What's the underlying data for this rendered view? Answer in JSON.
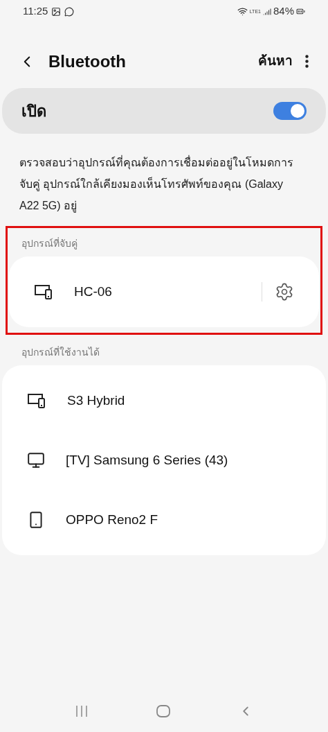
{
  "status_bar": {
    "time": "11:25",
    "network": "LTE1",
    "battery": "84%"
  },
  "header": {
    "title": "Bluetooth",
    "action": "ค้นหา"
  },
  "master_switch": {
    "label": "เปิด",
    "on": true
  },
  "description": "ตรวจสอบว่าอุปกรณ์ที่คุณต้องการเชื่อมต่ออยู่ในโหมดการจับคู่ อุปกรณ์ใกล้เคียงมองเห็นโทรศัพท์ของคุณ (Galaxy A22 5G) อยู่",
  "sections": [
    {
      "title": "อุปกรณ์ที่จับคู่",
      "highlighted": true,
      "devices": [
        {
          "kind": "multi",
          "name": "HC-06",
          "settings": true
        }
      ]
    },
    {
      "title": "อุปกรณ์ที่ใช้งานได้",
      "highlighted": false,
      "devices": [
        {
          "kind": "multi",
          "name": "S3 Hybrid",
          "settings": false
        },
        {
          "kind": "tv",
          "name": "[TV] Samsung 6 Series (43)",
          "settings": false
        },
        {
          "kind": "phone",
          "name": "OPPO Reno2 F",
          "settings": false
        }
      ]
    }
  ]
}
